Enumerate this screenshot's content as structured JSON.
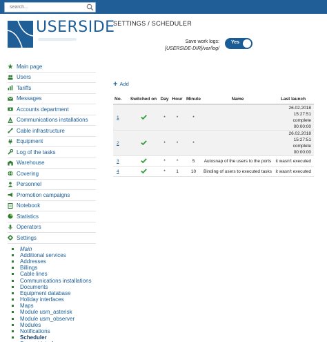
{
  "search": {
    "placeholder": "search..."
  },
  "logo": {
    "text": "USERSIDE"
  },
  "sidebar": {
    "items": [
      {
        "label": "Main page",
        "icon": "star-icon"
      },
      {
        "label": "Users",
        "icon": "users-icon"
      },
      {
        "label": "Tariffs",
        "icon": "tariffs-chart-icon"
      },
      {
        "label": "Messages",
        "icon": "envelope-icon"
      },
      {
        "label": "Accounts department",
        "icon": "money-icon"
      },
      {
        "label": "Communications installations",
        "icon": "tower-icon"
      },
      {
        "label": "Cable infrastructure",
        "icon": "cable-icon"
      },
      {
        "label": "Equipment",
        "icon": "plug-icon"
      },
      {
        "label": "Log of the tasks",
        "icon": "wrench-icon"
      },
      {
        "label": "Warehouse",
        "icon": "warehouse-icon"
      },
      {
        "label": "Covering",
        "icon": "globe-icon"
      },
      {
        "label": "Personnel",
        "icon": "person-icon"
      },
      {
        "label": "Promotion campaigns",
        "icon": "megaphone-icon"
      },
      {
        "label": "Notebook",
        "icon": "notebook-icon"
      },
      {
        "label": "Statistics",
        "icon": "pie-chart-icon"
      },
      {
        "label": "Operators",
        "icon": "microphone-icon"
      },
      {
        "label": "Settings",
        "icon": "gear-icon"
      }
    ],
    "settings_sub": [
      "Main",
      "Additional services",
      "Addresses",
      "Billings",
      "Cable lines",
      "Communications installations",
      "Documents",
      "Equipment database",
      "Holiday interfaces",
      "Maps",
      "Module usm_asterisk",
      "Module usm_observer",
      "Modules",
      "Notifications",
      "Scheduler",
      "Support interface"
    ]
  },
  "page": {
    "title": "SETTINGS / SCHEDULER"
  },
  "save_logs": {
    "label": "Save work logs:",
    "path": "[USERSIDE-DIR]/var/log/",
    "toggle": "Yes"
  },
  "add_label": "Add",
  "table": {
    "headers": [
      "No.",
      "Switched on",
      "Day",
      "Hour",
      "Minute",
      "Name",
      "Last launch"
    ],
    "rows": [
      {
        "no": "1",
        "day": "*",
        "hour": "*",
        "minute": "*",
        "name": "",
        "last_launch": [
          "26.02.2018 15:27:51",
          "complete",
          "00:00:00"
        ]
      },
      {
        "no": "2",
        "day": "*",
        "hour": "*",
        "minute": "*",
        "name": "",
        "last_launch": [
          "26.02.2018 15:27:51",
          "complete",
          "00:00:00"
        ]
      },
      {
        "no": "3",
        "day": "*",
        "hour": "*",
        "minute": "5",
        "name": "Autosnap of the users to the ports",
        "last_launch": [
          "it wasn't executed"
        ]
      },
      {
        "no": "4",
        "day": "*",
        "hour": "1",
        "minute": "10",
        "name": "Binding of users to executed tasks",
        "last_launch": [
          "it wasn't executed"
        ]
      }
    ]
  },
  "colors": {
    "topbar": "#1f5e96",
    "link": "#1a5d96",
    "icon_green": "#2e7d32"
  }
}
